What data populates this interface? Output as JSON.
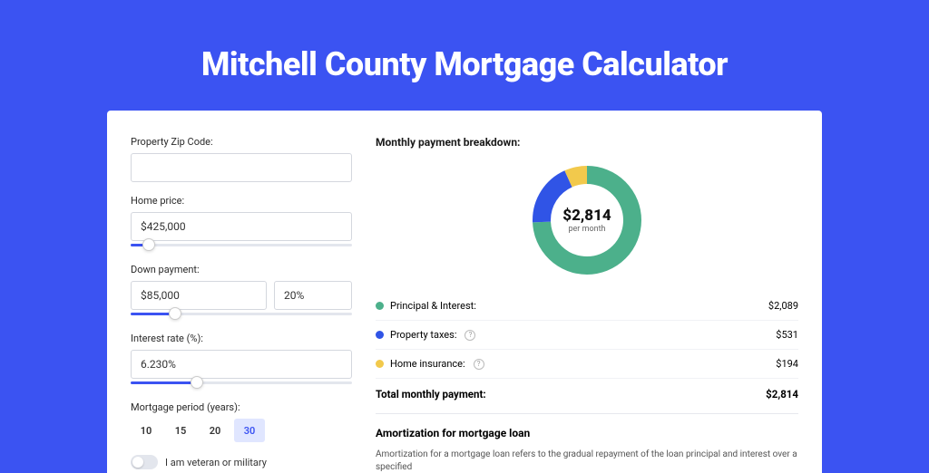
{
  "title": "Mitchell County Mortgage Calculator",
  "form": {
    "zip": {
      "label": "Property Zip Code:",
      "value": ""
    },
    "price": {
      "label": "Home price:",
      "value": "$425,000",
      "slider_pct": 8
    },
    "down": {
      "label": "Down payment:",
      "value": "$85,000",
      "pct": "20%",
      "slider_pct": 20
    },
    "rate": {
      "label": "Interest rate (%):",
      "value": "6.230%",
      "slider_pct": 30
    },
    "period": {
      "label": "Mortgage period (years):",
      "options": [
        "10",
        "15",
        "20",
        "30"
      ],
      "selected": "30"
    },
    "veteran": {
      "label": "I am veteran or military",
      "on": false
    }
  },
  "breakdown": {
    "heading": "Monthly payment breakdown:",
    "center_amount": "$2,814",
    "center_sub": "per month",
    "items": [
      {
        "label": "Principal & Interest:",
        "value": "$2,089",
        "color": "#4cb08b",
        "info": false
      },
      {
        "label": "Property taxes:",
        "value": "$531",
        "color": "#3054e6",
        "info": true
      },
      {
        "label": "Home insurance:",
        "value": "$194",
        "color": "#f2c94c",
        "info": true
      }
    ],
    "total_label": "Total monthly payment:",
    "total_value": "$2,814"
  },
  "amort": {
    "title": "Amortization for mortgage loan",
    "text": "Amortization for a mortgage loan refers to the gradual repayment of the loan principal and interest over a specified"
  },
  "chart_data": {
    "type": "pie",
    "title": "Monthly payment breakdown",
    "series": [
      {
        "name": "Principal & Interest",
        "value": 2089,
        "color": "#4cb08b"
      },
      {
        "name": "Property taxes",
        "value": 531,
        "color": "#3054e6"
      },
      {
        "name": "Home insurance",
        "value": 194,
        "color": "#f2c94c"
      }
    ],
    "total": 2814
  }
}
